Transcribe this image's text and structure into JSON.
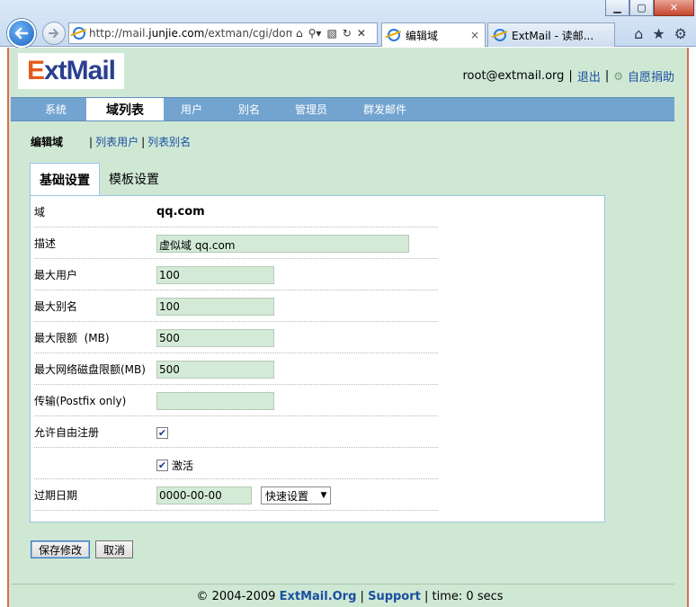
{
  "browser": {
    "url_prefix": "http://mail.",
    "url_host": "junjie.com",
    "url_path": "/extman/cgi/dom",
    "tabs": [
      {
        "title": "编辑域",
        "close": "×"
      },
      {
        "title": "ExtMail - 读邮..."
      }
    ]
  },
  "logo": {
    "e": "E",
    "rest": "xtMail"
  },
  "userbar": {
    "email": "root@extmail.org",
    "logout": "退出",
    "donate": "自愿捐助"
  },
  "menu": [
    {
      "label": "系统"
    },
    {
      "label": "域列表",
      "active": true
    },
    {
      "label": "用户"
    },
    {
      "label": "别名"
    },
    {
      "label": "管理员"
    },
    {
      "label": "群发邮件"
    }
  ],
  "subnav": {
    "current": "编辑域",
    "list_users": "列表用户",
    "list_aliases": "列表别名"
  },
  "tabs": {
    "basic": "基础设置",
    "template": "模板设置"
  },
  "form": {
    "domain_label": "域",
    "domain_value": "qq.com",
    "desc_label": "描述",
    "desc_value": "虚似域 qq.com",
    "max_users_label": "最大用户",
    "max_users_value": "100",
    "max_alias_label": "最大别名",
    "max_alias_value": "100",
    "max_quota_label": "最大限额  (MB)",
    "max_quota_value": "500",
    "max_netdisk_label": "最大网络磁盘限额(MB)",
    "max_netdisk_value": "500",
    "transport_label": "传输(Postfix only)",
    "transport_value": "",
    "allow_signup_label": "允许自由注册",
    "active_label": "激活",
    "expire_label": "过期日期",
    "expire_value": "0000-00-00",
    "quick_set": "快速设置"
  },
  "buttons": {
    "save": "保存修改",
    "cancel": "取消"
  },
  "footer": {
    "copyright": "© 2004-2009",
    "brand": "ExtMail.Org",
    "support": "Support",
    "time": "time: 0 secs"
  }
}
